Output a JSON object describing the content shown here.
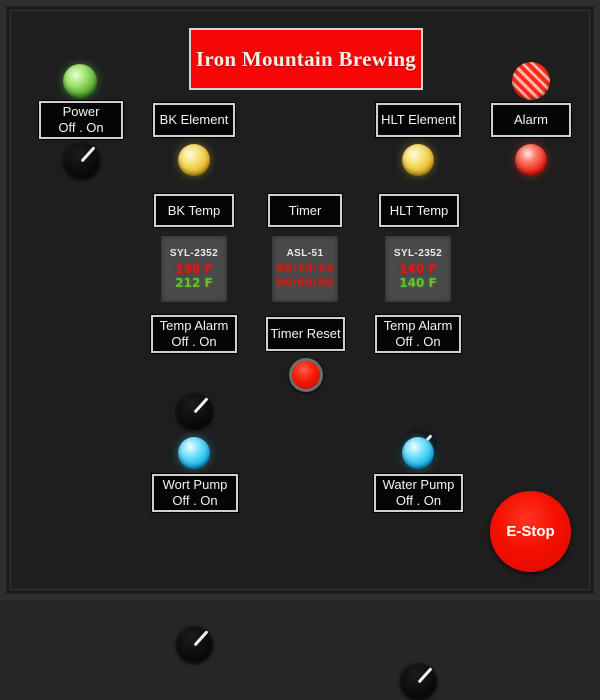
{
  "panel": {
    "title": "Iron Mountain Brewing",
    "background_color": "#1e1e1e",
    "banner_color": "#f60606"
  },
  "controls": {
    "power": {
      "label_line1": "Power",
      "label_line2": "Off . On",
      "lamp": "green-led",
      "knob": "rotary-selector-switch"
    },
    "bk_element": {
      "label": "BK Element",
      "lamp": "amber-led"
    },
    "hlt_element": {
      "label": "HLT Element",
      "lamp": "amber-led"
    },
    "alarm": {
      "label": "Alarm",
      "siren": "siren-icon",
      "lamp": "red-led"
    },
    "bk_temp": {
      "label": "BK Temp",
      "model": "SYL-2352",
      "pv": "198 F",
      "sv": "212 F"
    },
    "timer": {
      "label": "Timer",
      "model": "ASL-51",
      "elapsed": "00:10:24",
      "preset": "00:60:00"
    },
    "hlt_temp": {
      "label": "HLT Temp",
      "model": "SYL-2352",
      "pv": "140 F",
      "sv": "140 F"
    },
    "bk_temp_alarm": {
      "label_line1": "Temp Alarm",
      "label_line2": "Off . On"
    },
    "hlt_temp_alarm": {
      "label_line1": "Temp Alarm",
      "label_line2": "Off . On"
    },
    "timer_reset": {
      "label": "Timer Reset",
      "button": "red-pushbutton"
    },
    "wort_pump": {
      "label_line1": "Wort Pump",
      "label_line2": "Off . On",
      "lamp": "cyan-led"
    },
    "water_pump": {
      "label_line1": "Water Pump",
      "label_line2": "Off . On",
      "lamp": "cyan-led"
    },
    "estop": {
      "label": "E-Stop"
    }
  }
}
